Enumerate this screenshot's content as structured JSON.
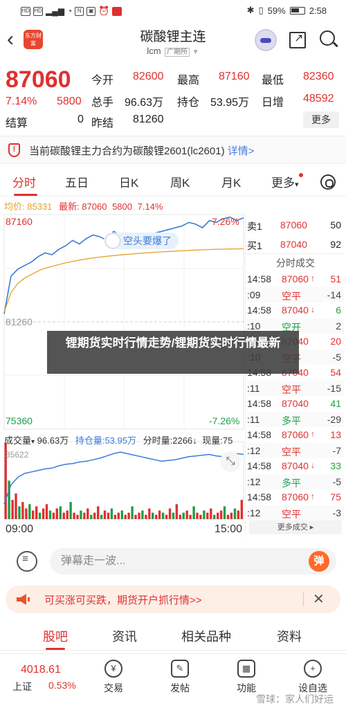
{
  "status_bar": {
    "icons_left": [
      "hd1-icon",
      "hd2-icon",
      "signal-icon",
      "wifi-icon",
      "nfc-icon",
      "sim-icon",
      "clock-icon",
      "app-icon"
    ],
    "battery": "59%",
    "time": "2:58"
  },
  "header": {
    "app_logo": "东方财富",
    "title": "碳酸锂主连",
    "symbol": "lcm",
    "market_tag": "广期所"
  },
  "quote": {
    "price": "87060",
    "change_pct": "7.14%",
    "change": "5800",
    "open_label": "今开",
    "open": "82600",
    "high_label": "最高",
    "high": "87160",
    "low_label": "最低",
    "low": "82360",
    "volume_label": "总手",
    "volume": "96.63万",
    "oi_label": "持仓",
    "oi": "53.95万",
    "daily_add_label": "日增",
    "daily_add": "48592",
    "settle_label": "结算",
    "settle": "0",
    "prev_settle_label": "昨结",
    "prev_settle": "81260",
    "more_label": "更多"
  },
  "notice": {
    "text": "当前碳酸锂主力合约为碳酸锂2601(lc2601)",
    "link": "详情>"
  },
  "period_tabs": [
    "分时",
    "五日",
    "日K",
    "周K",
    "月K",
    "更多"
  ],
  "legend": {
    "avg_label": "均价:",
    "avg_value": "85331",
    "latest_label": "最新:",
    "latest_value": "87060",
    "latest_change": "5800",
    "latest_pct": "7.14%"
  },
  "chart_labels": {
    "y_top": "87160",
    "y_top_pct": "7.26%",
    "y_mid": "81260",
    "y_bottom": "75360",
    "y_bottom_pct": "-7.26%",
    "bubble": "空头要爆了",
    "vol_max": "35622"
  },
  "chart_data": {
    "type": "line",
    "x_start": "09:00",
    "x_end": "15:00",
    "ylim": [
      75360,
      87160
    ],
    "reference": 81260,
    "series": [
      {
        "values": [
          81700,
          83800,
          84200,
          84400,
          84600,
          84900,
          85100,
          85000,
          85300,
          85500,
          85800,
          85600,
          85900,
          86100,
          86000,
          85800,
          86300,
          86100,
          86000,
          85900,
          85700,
          86000,
          86200,
          86300,
          86400,
          86500,
          86600,
          86800,
          86700,
          86500,
          86900,
          86800,
          87000,
          87100,
          86900,
          87060
        ]
      },
      {
        "values": [
          81800,
          82900,
          83400,
          83700,
          83900,
          84100,
          84250,
          84350,
          84450,
          84550,
          84630,
          84700,
          84760,
          84820,
          84870,
          84910,
          84950,
          84990,
          85020,
          85050,
          85080,
          85110,
          85140,
          85160,
          85180,
          85200,
          85220,
          85240,
          85260,
          85275,
          85290,
          85300,
          85310,
          85320,
          85325,
          85331
        ]
      }
    ],
    "volume": {
      "max": 35622,
      "values": [
        35622,
        18000,
        9000,
        12000,
        6000,
        8000,
        5000,
        7000,
        4000,
        6000,
        3000,
        5000,
        7000,
        4000,
        3000,
        5000,
        6000,
        3000,
        4000,
        8000,
        3000,
        2000,
        4000,
        3000,
        5000,
        2000,
        3000,
        6000,
        2000,
        4000,
        3000,
        5000,
        2000,
        3000,
        4000,
        2000,
        3000,
        6000,
        2000,
        3000,
        4000,
        2000,
        5000,
        3000,
        2000,
        4000,
        3000,
        2000,
        5000,
        3000,
        7000,
        2000,
        3000,
        4000,
        2000,
        6000,
        3000,
        2000,
        4000,
        3000,
        5000,
        2000,
        3000,
        4000,
        6000,
        2000,
        3000,
        5000,
        4000,
        9000
      ]
    },
    "open_interest": [
      0.2,
      0.45,
      0.55,
      0.6,
      0.62,
      0.64,
      0.66,
      0.67,
      0.7,
      0.72,
      0.73,
      0.75,
      0.76,
      0.78,
      0.8,
      0.83,
      0.86,
      0.88,
      0.86,
      0.84,
      0.82,
      0.8,
      0.78,
      0.76,
      0.77,
      0.78,
      0.8,
      0.82,
      0.83,
      0.84,
      0.85,
      0.83,
      0.82,
      0.84,
      0.86,
      0.85
    ]
  },
  "order_book": [
    {
      "label": "卖1",
      "price": "87060",
      "qty": "50"
    },
    {
      "label": "买1",
      "price": "87040",
      "qty": "92"
    }
  ],
  "trades_title": "分时成交",
  "trades": [
    {
      "time": "14:58",
      "price": "87060",
      "dir": "↑",
      "qty": "51",
      "price_color": "red",
      "qty_color": "red"
    },
    {
      "time": ":09",
      "price": "空平",
      "dir": "",
      "qty": "-14",
      "price_color": "red",
      "qty_color": "gray"
    },
    {
      "time": "14:58",
      "price": "87040",
      "dir": "↓",
      "qty": "6",
      "price_color": "red",
      "qty_color": "green"
    },
    {
      "time": ":10",
      "price": "空开",
      "dir": "",
      "qty": "2",
      "price_color": "green",
      "qty_color": "gray"
    },
    {
      "time": "14:58",
      "price": "87040",
      "dir": "",
      "qty": "20",
      "price_color": "red",
      "qty_color": "red"
    },
    {
      "time": ":10",
      "price": "空平",
      "dir": "",
      "qty": "-5",
      "price_color": "red",
      "qty_color": "gray"
    },
    {
      "time": "14:58",
      "price": "87040",
      "dir": "",
      "qty": "54",
      "price_color": "red",
      "qty_color": "red"
    },
    {
      "time": ":11",
      "price": "空平",
      "dir": "",
      "qty": "-15",
      "price_color": "red",
      "qty_color": "gray"
    },
    {
      "time": "14:58",
      "price": "87040",
      "dir": "",
      "qty": "41",
      "price_color": "red",
      "qty_color": "green"
    },
    {
      "time": ":11",
      "price": "多平",
      "dir": "",
      "qty": "-29",
      "price_color": "green",
      "qty_color": "gray"
    },
    {
      "time": "14:58",
      "price": "87060",
      "dir": "↑",
      "qty": "13",
      "price_color": "red",
      "qty_color": "red"
    },
    {
      "time": ":12",
      "price": "空平",
      "dir": "",
      "qty": "-7",
      "price_color": "red",
      "qty_color": "gray"
    },
    {
      "time": "14:58",
      "price": "87040",
      "dir": "↓",
      "qty": "33",
      "price_color": "red",
      "qty_color": "green"
    },
    {
      "time": ":12",
      "price": "多平",
      "dir": "",
      "qty": "-5",
      "price_color": "green",
      "qty_color": "gray"
    },
    {
      "time": "14:58",
      "price": "87060",
      "dir": "↑",
      "qty": "75",
      "price_color": "red",
      "qty_color": "red"
    },
    {
      "time": ":12",
      "price": "空平",
      "dir": "",
      "qty": "-3",
      "price_color": "red",
      "qty_color": "gray"
    }
  ],
  "trades_more": "更多成交 ▸",
  "volume_legend": {
    "label": "成交量",
    "dropdown": "▾",
    "vol": "96.63万",
    "oi_label": "持仓量:53.95万",
    "min_vol": "分时量:2266↓",
    "now_label": "现量:75"
  },
  "time_axis": {
    "start": "09:00",
    "end": "15:00"
  },
  "overlay_text": "锂期货实时行情走势/锂期货实时行情最新",
  "comment": {
    "placeholder": "弹幕走一波...",
    "danmu": "弹"
  },
  "promo": {
    "text": "可买涨可买跌，期货开户抓行情>>"
  },
  "sub_tabs": [
    "股吧",
    "资讯",
    "相关品种",
    "资料"
  ],
  "bottom_nav": {
    "index_value": "4018.61",
    "index_name": "上证",
    "index_pct": "0.53%",
    "items": [
      "交易",
      "发帖",
      "功能",
      "设自选"
    ]
  },
  "watermark": "雪球：家人们好运",
  "colors": {
    "up": "#e03030",
    "down": "#1e9f46",
    "avg": "#e3a32b",
    "price_line": "#3b7bd8"
  }
}
